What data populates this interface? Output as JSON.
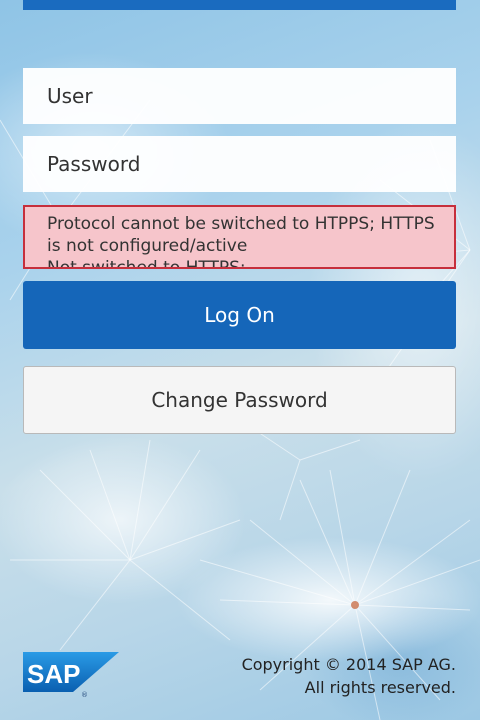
{
  "form": {
    "user_placeholder": "User",
    "password_placeholder": "Password"
  },
  "error": {
    "line1": "Protocol cannot be switched to HTPPS; HTTPS",
    "line2": "is not configured/active",
    "line3": "Not switched to HTTPS; ..."
  },
  "buttons": {
    "logon_label": "Log On",
    "change_password_label": "Change Password"
  },
  "footer": {
    "logo_text": "SAP",
    "copyright_line1": "Copyright © 2014 SAP AG.",
    "copyright_line2": "All rights reserved."
  },
  "colors": {
    "primary": "#1566b9",
    "error_bg": "#f6c5cb",
    "error_border": "#c62f3c"
  }
}
